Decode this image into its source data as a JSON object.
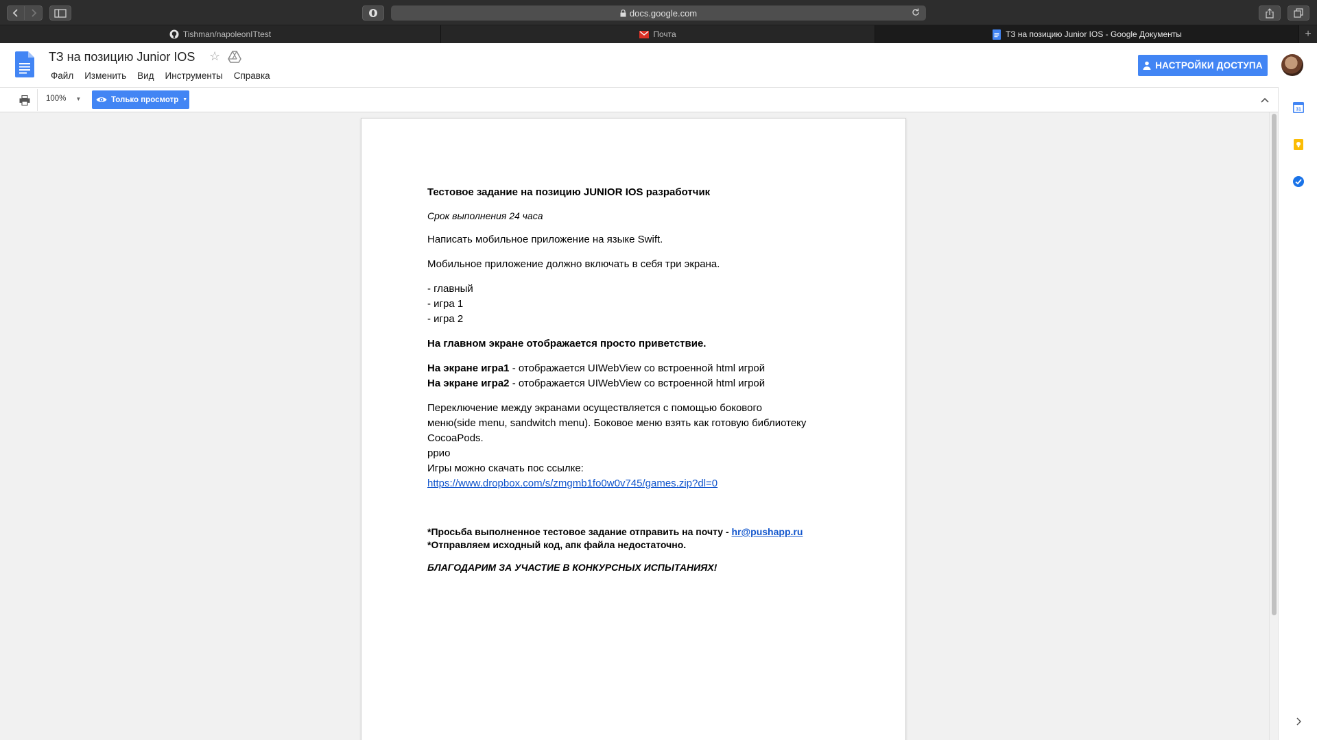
{
  "browser": {
    "url": "docs.google.com",
    "tabs": [
      {
        "title": "Tishman/napoleonITtest",
        "favicon": "github-icon"
      },
      {
        "title": "Почта",
        "favicon": "gmail-icon"
      },
      {
        "title": "ТЗ на позицию Junior IOS - Google Документы",
        "favicon": "google-docs-icon"
      }
    ],
    "new_tab_label": "+"
  },
  "docs": {
    "title": "ТЗ на позицию Junior IOS",
    "menu": [
      "Файл",
      "Изменить",
      "Вид",
      "Инструменты",
      "Справка"
    ],
    "share_button": "НАСТРОЙКИ ДОСТУПА",
    "zoom": "100%",
    "mode_button": "Только просмотр",
    "accent_color": "#4285f4"
  },
  "document": {
    "heading": "Тестовое задание на позицию JUNIOR IOS разработчик",
    "deadline": "Срок выполнения  24 часа",
    "p1": "Написать мобильное приложение на языке Swift.",
    "p2": "Мобильное приложение должно включать в себя три экрана.",
    "list": [
      "- главный",
      "- игра 1",
      "- игра 2"
    ],
    "main_screen": "На главном экране отображается просто приветствие.",
    "game1_label": "На экране игра1",
    "game1_text": " - отображается UIWebView со встроенной html игрой",
    "game2_label": "На экране игра2",
    "game2_text": " - отображается UIWebView со встроенной html игрой",
    "switch_line1": "Переключение между экранами осуществляется с помощью бокового",
    "switch_line2": "меню(side menu, sandwitch menu). Боковое меню взять как готовую библиотеку",
    "switch_line3": "CocoaPods.",
    "stray": "ррио",
    "download_text": "Игры можно скачать пос ссылке:",
    "download_link": "https://www.dropbox.com/s/zmgmb1fo0w0v745/games.zip?dl=0",
    "request_text": "*Просьба выполненное тестовое задание отправить на почту - ",
    "email": "hr@pushapp.ru",
    "source_note": "*Отправляем исходный  код, апк файла недостаточно.",
    "thanks": "БЛАГОДАРИМ ЗА УЧАСТИЕ В КОНКУРСНЫХ ИСПЫТАНИЯХ!"
  },
  "side_panel": {
    "calendar_day": "31",
    "icons": [
      "calendar-icon",
      "keep-icon",
      "tasks-icon"
    ]
  }
}
